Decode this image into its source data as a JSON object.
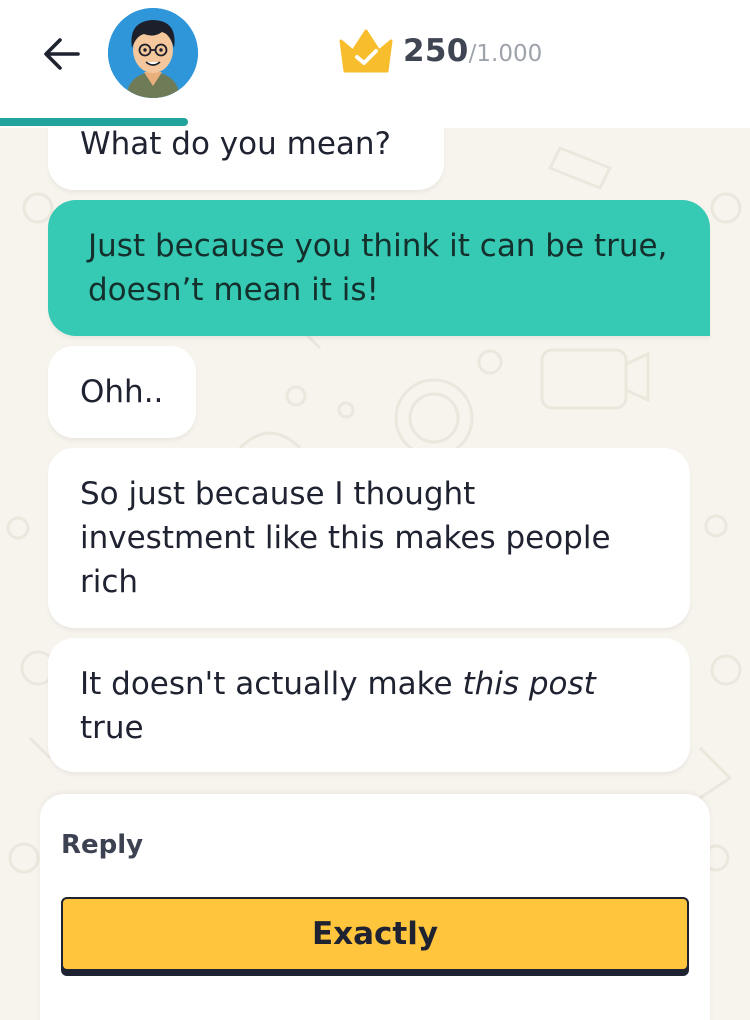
{
  "header": {
    "score_current": "250",
    "score_total": "/1.000",
    "progress": 0.25,
    "icons": [
      "back-arrow-icon",
      "avatar",
      "crown-check-icon"
    ],
    "accent_color": "#1fa39a"
  },
  "messages": [
    {
      "sender": "other",
      "text": "What do you mean?"
    },
    {
      "sender": "self",
      "text": "Just because you think it can be true, doesn’t mean it is!"
    },
    {
      "sender": "other",
      "text": "Ohh.."
    },
    {
      "sender": "other",
      "text": "So just because I thought investment like this makes people rich"
    },
    {
      "sender": "other",
      "text_before": "It doesn't actually make ",
      "text_emphasis": "this post",
      "text_after": "true"
    }
  ],
  "reply": {
    "label": "Reply",
    "options": [
      "Exactly"
    ]
  },
  "colors": {
    "self_bubble": "#36c9b4",
    "option_button": "#ffc53d",
    "crown": "#f7bd2c"
  }
}
